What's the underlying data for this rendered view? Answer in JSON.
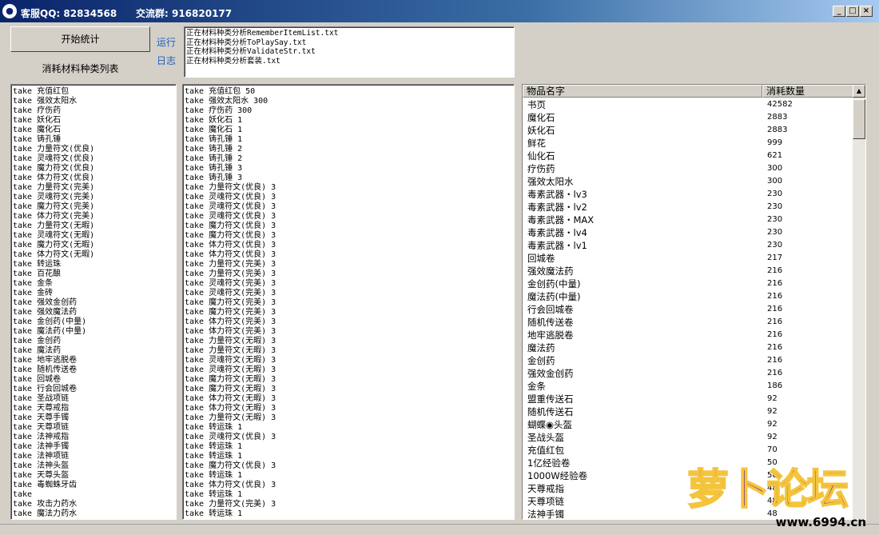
{
  "titlebar": {
    "logo_glyph": "●",
    "support_qq": "客服QQ: 82834568",
    "group": "交流群: 916820177",
    "btn_minimize": "_",
    "btn_maximize": "□",
    "btn_close": "×"
  },
  "controls": {
    "start_button": "开始统计",
    "run_link": "运行",
    "log_link": "日志",
    "list_caption": "消耗材料种类列表"
  },
  "log_lines": [
    "正在材料种类分析RememberItemList.txt",
    "正在材料种类分析ToPlaySay.txt",
    "正在材料种类分析ValidateStr.txt",
    "正在材料种类分析套装.txt"
  ],
  "material_list": [
    "take 充值红包",
    "take 强效太阳水",
    "take 疗伤药",
    "take 妖化石",
    "take 魔化石",
    "take 铸孔锤",
    "take 力量符文(优良)",
    "take 灵魂符文(优良)",
    "take 魔力符文(优良)",
    "take 体力符文(优良)",
    "take 力量符文(完美)",
    "take 灵魂符文(完美)",
    "take 魔力符文(完美)",
    "take 体力符文(完美)",
    "take 力量符文(无暇)",
    "take 灵魂符文(无暇)",
    "take 魔力符文(无暇)",
    "take 体力符文(无暇)",
    "take 转运珠",
    "take 百花酿",
    "take 金条",
    "take 金砖",
    "take 强效金创药",
    "take 强效魔法药",
    "take 金创药(中量)",
    "take 魔法药(中量)",
    "take 金创药",
    "take 魔法药",
    "take 地牢逃脱卷",
    "take 随机传送卷",
    "take 回城卷",
    "take 行会回城卷",
    "take 圣战项链",
    "take 天尊戒指",
    "take 天尊手镯",
    "take 天尊项链",
    "take 法神戒指",
    "take 法神手镯",
    "take 法神项链",
    "take 法神头盔",
    "take 天尊头盔",
    "take 毒蜘蛛牙齿",
    "take",
    "take 攻击力药水",
    "take 魔法力药水"
  ],
  "quantity_list": [
    "take 充值红包 50",
    "take 强效太阳水 300",
    "take 疗伤药 300",
    "take 妖化石 1",
    "take 魔化石 1",
    "take 铸孔锤 1",
    "take 铸孔锤 2",
    "take 铸孔锤 2",
    "take 铸孔锤 3",
    "take 铸孔锤 3",
    "take 力量符文(优良) 3",
    "take 灵魂符文(优良) 3",
    "take 灵魂符文(优良) 3",
    "take 灵魂符文(优良) 3",
    "take 魔力符文(优良) 3",
    "take 魔力符文(优良) 3",
    "take 体力符文(优良) 3",
    "take 体力符文(优良) 3",
    "take 力量符文(完美) 3",
    "take 力量符文(完美) 3",
    "take 灵魂符文(完美) 3",
    "take 灵魂符文(完美) 3",
    "take 魔力符文(完美) 3",
    "take 魔力符文(完美) 3",
    "take 体力符文(完美) 3",
    "take 体力符文(完美) 3",
    "take 力量符文(无暇) 3",
    "take 力量符文(无暇) 3",
    "take 灵魂符文(无暇) 3",
    "take 灵魂符文(无暇) 3",
    "take 魔力符文(无暇) 3",
    "take 魔力符文(无暇) 3",
    "take 体力符文(无暇) 3",
    "take 体力符文(无暇) 3",
    "take 力量符文(无暇) 3",
    "take 转运珠 1",
    "take 灵魂符文(优良) 3",
    "take 转运珠 1",
    "take 转运珠 1",
    "take 魔力符文(优良) 3",
    "take 转运珠 1",
    "take 体力符文(优良) 3",
    "take 转运珠 1",
    "take 力量符文(完美) 3",
    "take 转运珠 1"
  ],
  "table": {
    "col_name": "物品名字",
    "col_qty": "消耗数量",
    "rows": [
      {
        "name": "书页",
        "qty": "42582"
      },
      {
        "name": "魔化石",
        "qty": "2883"
      },
      {
        "name": "妖化石",
        "qty": "2883"
      },
      {
        "name": "鲜花",
        "qty": "999"
      },
      {
        "name": "仙化石",
        "qty": "621"
      },
      {
        "name": "疗伤药",
        "qty": "300"
      },
      {
        "name": "强效太阳水",
        "qty": "300"
      },
      {
        "name": "毒素武器・lv3",
        "qty": "230"
      },
      {
        "name": "毒素武器・lv2",
        "qty": "230"
      },
      {
        "name": "毒素武器・MAX",
        "qty": "230"
      },
      {
        "name": "毒素武器・lv4",
        "qty": "230"
      },
      {
        "name": "毒素武器・lv1",
        "qty": "230"
      },
      {
        "name": "回城卷",
        "qty": "217"
      },
      {
        "name": "强效魔法药",
        "qty": "216"
      },
      {
        "name": "金创药(中量)",
        "qty": "216"
      },
      {
        "name": "魔法药(中量)",
        "qty": "216"
      },
      {
        "name": "行会回城卷",
        "qty": "216"
      },
      {
        "name": "随机传送卷",
        "qty": "216"
      },
      {
        "name": "地牢逃脱卷",
        "qty": "216"
      },
      {
        "name": "魔法药",
        "qty": "216"
      },
      {
        "name": "金创药",
        "qty": "216"
      },
      {
        "name": "强效金创药",
        "qty": "216"
      },
      {
        "name": "金条",
        "qty": "186"
      },
      {
        "name": "盟重传送石",
        "qty": "92"
      },
      {
        "name": "随机传送石",
        "qty": "92"
      },
      {
        "name": "蝴蝶◉头盔",
        "qty": "92"
      },
      {
        "name": "圣战头盔",
        "qty": "92"
      },
      {
        "name": "充值红包",
        "qty": "70"
      },
      {
        "name": "1亿经验卷",
        "qty": "50"
      },
      {
        "name": "1000W经验卷",
        "qty": "50"
      },
      {
        "name": "天尊戒指",
        "qty": "48"
      },
      {
        "name": "天尊项链",
        "qty": "48"
      },
      {
        "name": "法神手镯",
        "qty": "48"
      }
    ]
  },
  "watermark": {
    "brand": "萝卜论坛",
    "url": "www.6994.cn"
  }
}
